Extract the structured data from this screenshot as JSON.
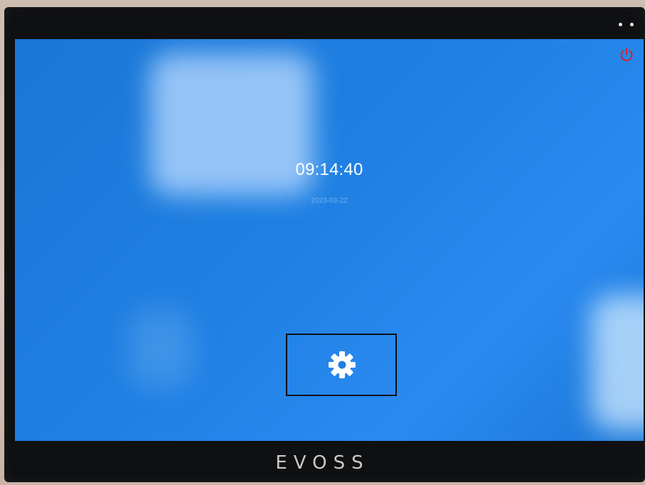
{
  "screen": {
    "time": "09:14:40",
    "date": "2023-03-22",
    "background_color": "#1f80e3"
  },
  "icons": {
    "power": "power-icon",
    "settings": "gear-icon",
    "power_color": "#d6202a"
  },
  "device": {
    "brand": "EVOSS"
  }
}
